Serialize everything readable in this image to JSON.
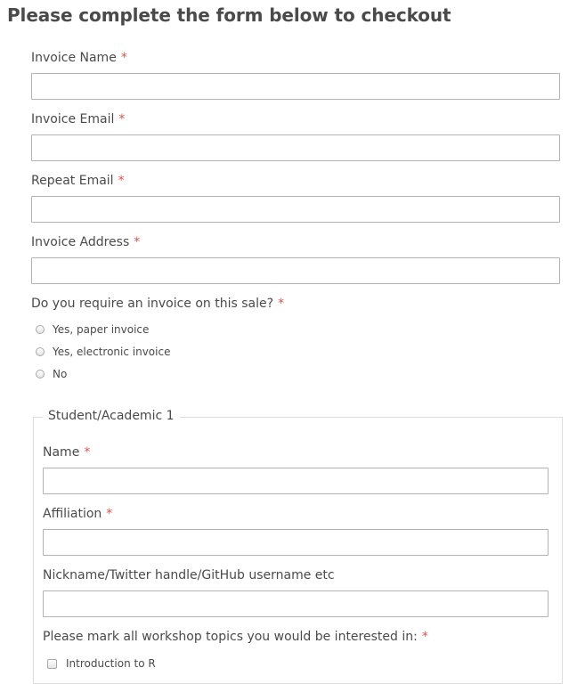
{
  "page": {
    "title": "Please complete the form below to checkout"
  },
  "required_marker": "*",
  "invoice": {
    "name_label": "Invoice Name",
    "name_value": "",
    "email_label": "Invoice Email",
    "email_value": "",
    "repeat_email_label": "Repeat Email",
    "repeat_email_value": "",
    "address_label": "Invoice Address",
    "address_value": ""
  },
  "invoice_question": {
    "label": "Do you require an invoice on this sale?",
    "options": [
      "Yes, paper invoice",
      "Yes, electronic invoice",
      "No"
    ]
  },
  "student": {
    "legend": "Student/Academic 1",
    "name_label": "Name",
    "name_value": "",
    "affiliation_label": "Affiliation",
    "affiliation_value": "",
    "nickname_label": "Nickname/Twitter handle/GitHub username etc",
    "nickname_value": "",
    "topics_label": "Please mark all workshop topics you would be interested in:",
    "topics": [
      "Introduction to R"
    ]
  }
}
